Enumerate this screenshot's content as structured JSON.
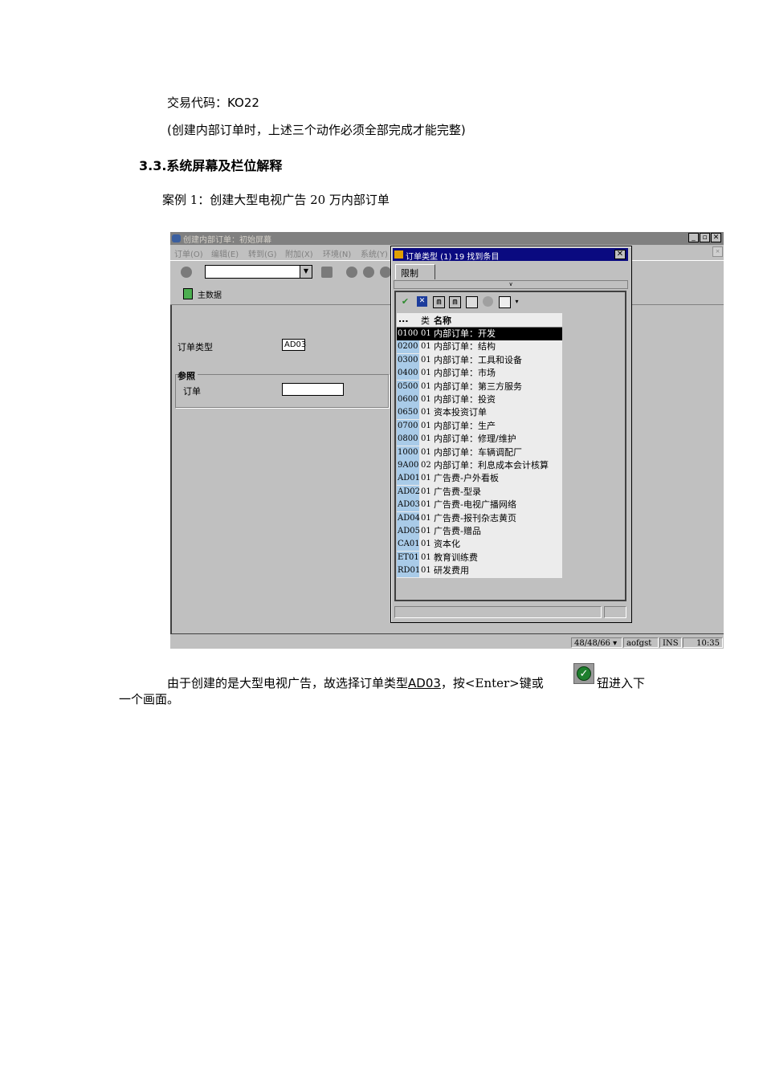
{
  "doc": {
    "line1": "交易代码：KO22",
    "line2": "(创建内部订单时，上述三个动作必须全部完成才能完整)",
    "heading": "3.3.系统屏幕及栏位解释",
    "case": "案例 1：创建大型电视广告 20 万内部订单",
    "bottom_a": "由于创建的是大型电视广告，故选择订单类型",
    "bottom_code": "AD03",
    "bottom_b": "，按<Enter>键或",
    "bottom_c": "钮进入下",
    "bottom_d": "一个画面。"
  },
  "sap": {
    "window_title": "创建内部订单：初始屏幕",
    "menu": [
      "订单(O)",
      "编辑(E)",
      "转到(G)",
      "附加(X)",
      "环境(N)",
      "系统(Y)"
    ],
    "app_button": "主数据",
    "order_type_label": "订单类型",
    "order_type_value": "AD03",
    "group_title": "参照",
    "order_label": "订单",
    "status": {
      "session": "48/48/66",
      "server": "aofgst",
      "mode": "INS",
      "time": "10:35"
    }
  },
  "popup": {
    "title": "订单类型  (1)   19 找到条目",
    "tab": "限制",
    "header": {
      "key": "...",
      "cat": "类",
      "name": "名称"
    },
    "rows": [
      {
        "key": "0100",
        "cat": "01",
        "name": "内部订单：开发"
      },
      {
        "key": "0200",
        "cat": "01",
        "name": "内部订单：结构"
      },
      {
        "key": "0300",
        "cat": "01",
        "name": "内部订单：工具和设备"
      },
      {
        "key": "0400",
        "cat": "01",
        "name": "内部订单：市场"
      },
      {
        "key": "0500",
        "cat": "01",
        "name": "内部订单：第三方服务"
      },
      {
        "key": "0600",
        "cat": "01",
        "name": "内部订单：投资"
      },
      {
        "key": "0650",
        "cat": "01",
        "name": "资本投资订单"
      },
      {
        "key": "0700",
        "cat": "01",
        "name": "内部订单：生产"
      },
      {
        "key": "0800",
        "cat": "01",
        "name": "内部订单：修理/维护"
      },
      {
        "key": "1000",
        "cat": "01",
        "name": "内部订单：车辆调配厂"
      },
      {
        "key": "9A00",
        "cat": "02",
        "name": "内部订单：利息成本会计核算"
      },
      {
        "key": "AD01",
        "cat": "01",
        "name": "广告费-户外看板"
      },
      {
        "key": "AD02",
        "cat": "01",
        "name": "广告费-型录"
      },
      {
        "key": "AD03",
        "cat": "01",
        "name": "广告费-电视广播网络"
      },
      {
        "key": "AD04",
        "cat": "01",
        "name": "广告费-报刊杂志黄页"
      },
      {
        "key": "AD05",
        "cat": "01",
        "name": "广告费-赠品"
      },
      {
        "key": "CA01",
        "cat": "01",
        "name": "资本化"
      },
      {
        "key": "ET01",
        "cat": "01",
        "name": "教育训练费"
      },
      {
        "key": "RD01",
        "cat": "01",
        "name": "研发费用"
      }
    ]
  }
}
